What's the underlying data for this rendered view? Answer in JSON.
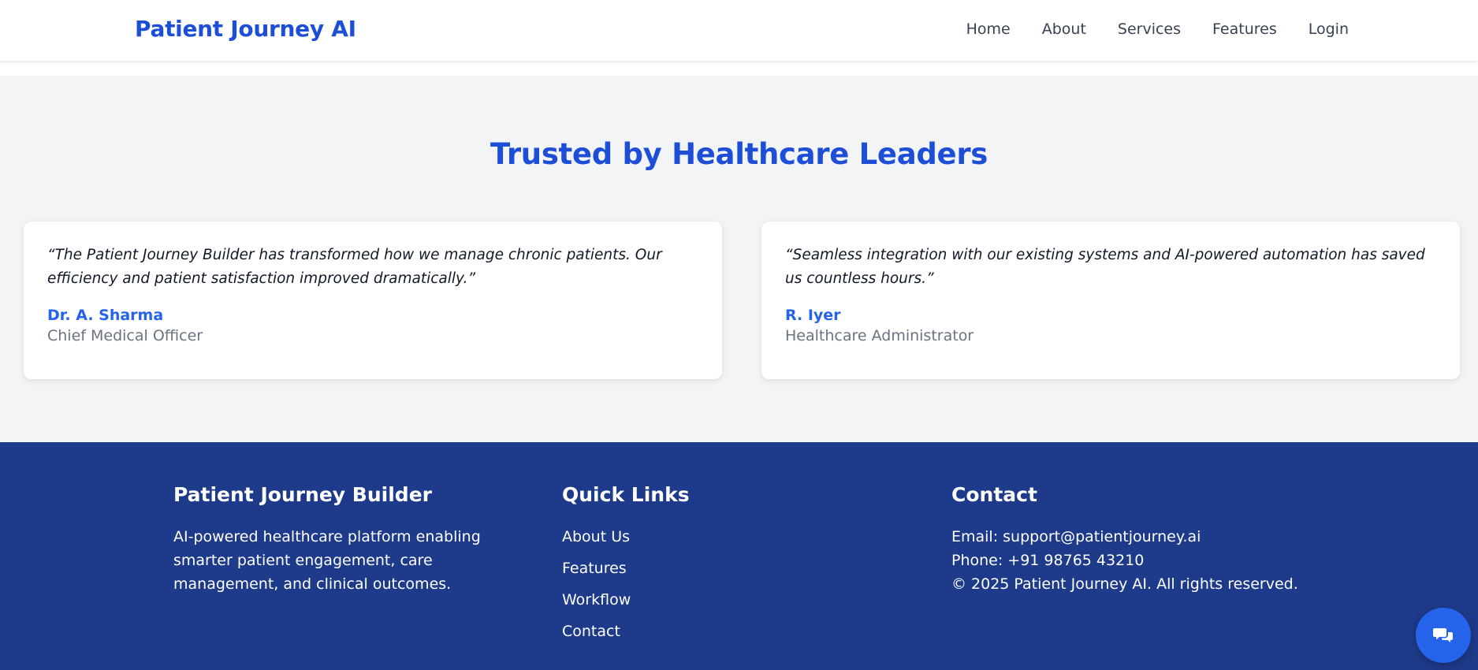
{
  "nav": {
    "brand": "Patient Journey AI",
    "links": [
      "Home",
      "About",
      "Services",
      "Features",
      "Login"
    ]
  },
  "testimonials": {
    "title": "Trusted by Healthcare Leaders",
    "items": [
      {
        "quote": "“The Patient Journey Builder has transformed how we manage chronic patients. Our efficiency and patient satisfaction improved dramatically.”",
        "author": "Dr. A. Sharma",
        "role": "Chief Medical Officer"
      },
      {
        "quote": "“Seamless integration with our existing systems and AI-powered automation has saved us countless hours.”",
        "author": "R. Iyer",
        "role": "Healthcare Administrator"
      }
    ]
  },
  "footer": {
    "about": {
      "heading": "Patient Journey Builder",
      "text": "AI-powered healthcare platform enabling smarter patient engagement, care management, and clinical outcomes."
    },
    "quick_links": {
      "heading": "Quick Links",
      "links": [
        "About Us",
        "Features",
        "Workflow",
        "Contact"
      ]
    },
    "contact": {
      "heading": "Contact",
      "email": "Email: support@patientjourney.ai",
      "phone": "Phone: +91 98765 43210",
      "copyright": "© 2025 Patient Journey AI. All rights reserved."
    }
  },
  "chat": {
    "icon": "chat-bubbles-icon"
  },
  "colors": {
    "brand": "#1d4ed8",
    "accent": "#2563eb",
    "footer_bg": "#1e3a8a",
    "section_bg": "#f3f4f6"
  }
}
